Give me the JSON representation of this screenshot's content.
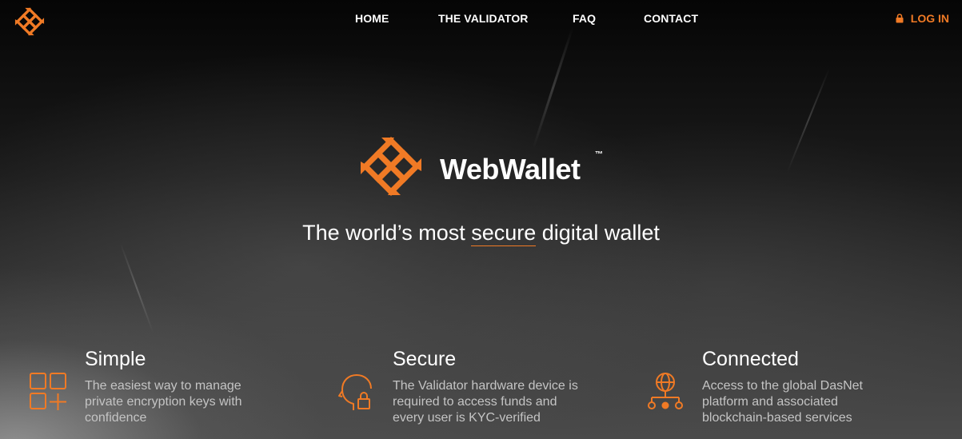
{
  "colors": {
    "accent": "#f07a25",
    "text": "#ffffff",
    "muted_text": "#c4c4c4"
  },
  "header": {
    "logo_icon": "webwallet-star-logo-icon",
    "nav": [
      {
        "label": "HOME"
      },
      {
        "label": "THE VALIDATOR"
      },
      {
        "label": "FAQ"
      },
      {
        "label": "CONTACT"
      }
    ],
    "login": {
      "label": "LOG IN",
      "icon": "lock-icon"
    }
  },
  "hero": {
    "brand": "WebWallet",
    "trademark": "™",
    "tagline_prefix": "The world’s most ",
    "tagline_highlight": "secure",
    "tagline_suffix": " digital wallet"
  },
  "features": [
    {
      "icon": "grid-plus-icon",
      "title": "Simple",
      "description": "The easiest way to manage private encryption keys with confidence"
    },
    {
      "icon": "head-lock-icon",
      "title": "Secure",
      "description": "The Validator hardware device is required to access funds and every user is KYC-verified"
    },
    {
      "icon": "globe-network-icon",
      "title": "Connected",
      "description": "Access to the global DasNet platform and associated blockchain-based services"
    }
  ]
}
